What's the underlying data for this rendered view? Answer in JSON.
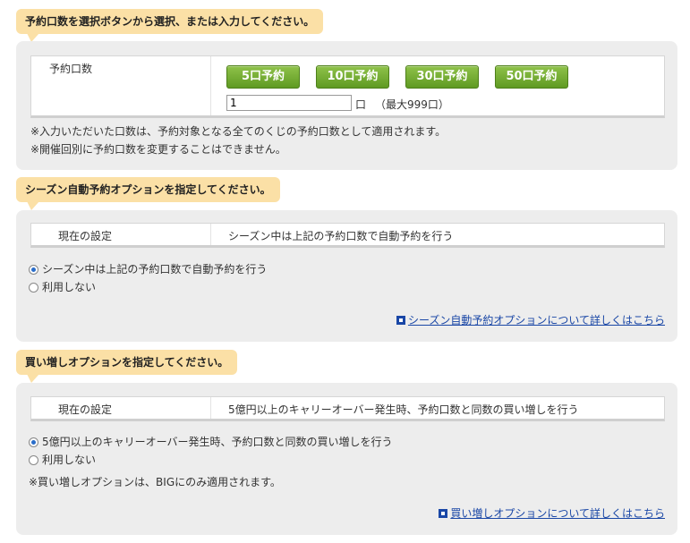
{
  "section1": {
    "tab_title": "予約口数を選択ボタンから選択、または入力してください。",
    "label": "予約口数",
    "buttons": [
      "5口予約",
      "10口予約",
      "30口予約",
      "50口予約"
    ],
    "quantity_value": "1",
    "unit": "口",
    "max_note": "（最大999口）",
    "notes": [
      "※入力いただいた口数は、予約対象となる全てのくじの予約口数として適用されます。",
      "※開催回別に予約口数を変更することはできません。"
    ]
  },
  "section2": {
    "tab_title": "シーズン自動予約オプションを指定してください。",
    "current_label": "現在の設定",
    "current_value": "シーズン中は上記の予約口数で自動予約を行う",
    "options": [
      "シーズン中は上記の予約口数で自動予約を行う",
      "利用しない"
    ],
    "selected_index": 0,
    "link_text": "シーズン自動予約オプションについて詳しくはこちら"
  },
  "section3": {
    "tab_title": "買い増しオプションを指定してください。",
    "current_label": "現在の設定",
    "current_value": "5億円以上のキャリーオーバー発生時、予約口数と同数の買い増しを行う",
    "options": [
      "5億円以上のキャリーオーバー発生時、予約口数と同数の買い増しを行う",
      "利用しない"
    ],
    "selected_index": 0,
    "note": "※買い増しオプションは、BIGにのみ適用されます。",
    "link_text": "買い増しオプションについて詳しくはこちら"
  },
  "colors": {
    "tab_background": "#fbe0a6",
    "panel_background": "#ededed",
    "button_green": "#6aa82d",
    "link_blue": "#1a47a6"
  }
}
